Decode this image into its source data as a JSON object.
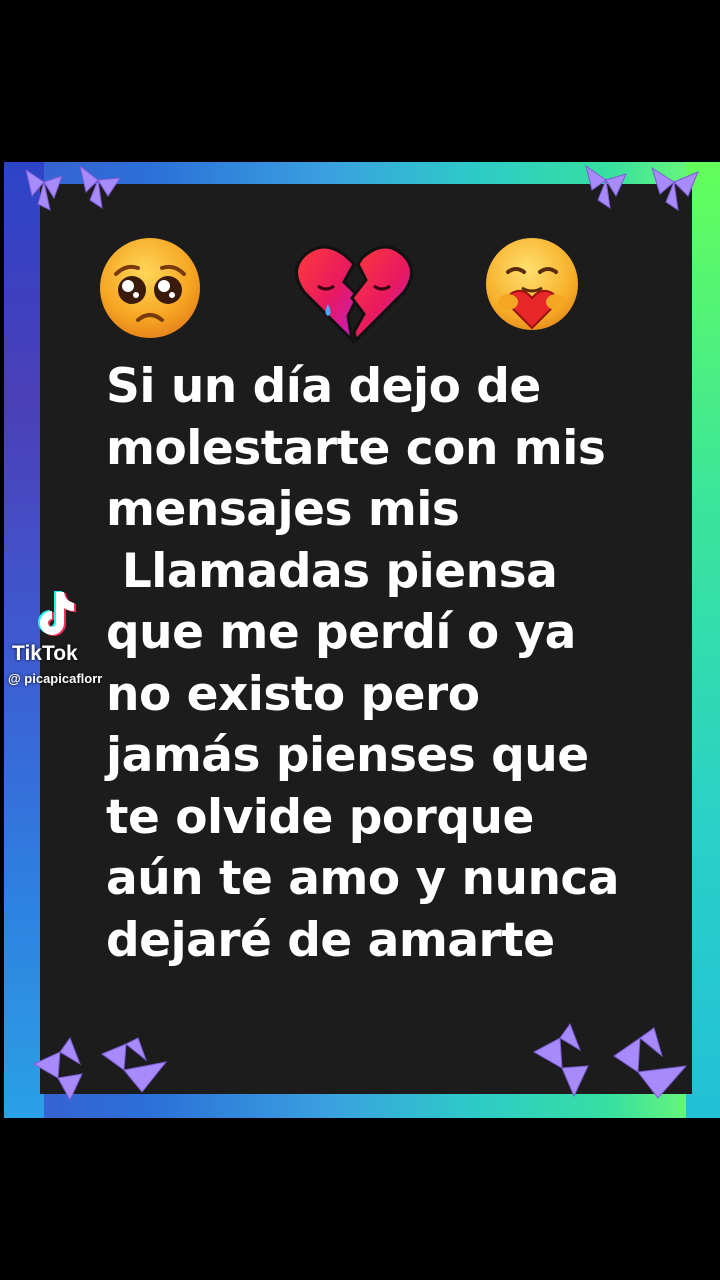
{
  "message": {
    "lines": [
      "Si un día dejo de",
      "molestarte con mis",
      "mensajes mis",
      " Llamadas piensa",
      "que me perdí o ya",
      "no existo pero",
      "jamás pienses que",
      "te olvide porque",
      "aún te amo y nunca",
      "dejaré de amarte"
    ]
  },
  "emojis": [
    "pleading-face-icon",
    "broken-heart-icon",
    "hugging-heart-face-icon"
  ],
  "watermark": {
    "brand": "TikTok",
    "handle": "@ picapicaflorr"
  },
  "colors": {
    "background": "#000000",
    "panel": "#1c1c1c",
    "text": "#ffffff",
    "butterfly": "#a78bfa"
  }
}
